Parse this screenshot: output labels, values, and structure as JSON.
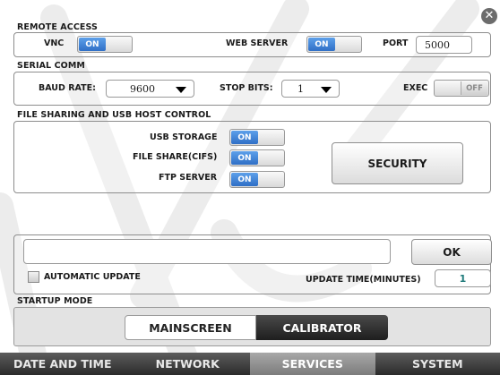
{
  "window": {
    "close_symbol": "✕"
  },
  "remote_access": {
    "title": "REMOTE ACCESS",
    "vnc_label": "VNC",
    "vnc_state": "ON",
    "web_server_label": "WEB SERVER",
    "web_server_state": "ON",
    "port_label": "PORT",
    "port_value": "5000"
  },
  "serial_comm": {
    "title": "SERIAL COMM",
    "baud_rate_label": "BAUD RATE:",
    "baud_rate_value": "9600",
    "stop_bits_label": "STOP BITS:",
    "stop_bits_value": "1",
    "exec_label": "EXEC",
    "exec_state": "OFF"
  },
  "file_sharing": {
    "title": "FILE SHARING AND USB HOST CONTROL",
    "usb_storage_label": "USB STORAGE",
    "usb_storage_state": "ON",
    "file_share_label": "FILE SHARE(CIFS)",
    "file_share_state": "ON",
    "ftp_server_label": "FTP SERVER",
    "ftp_server_state": "ON",
    "security_label": "SECURITY"
  },
  "update": {
    "input_value": "",
    "ok_label": "OK",
    "auto_update_label": "AUTOMATIC UPDATE",
    "update_time_label": "UPDATE TIME(MINUTES)",
    "update_time_value": "1"
  },
  "startup_mode": {
    "title": "STARTUP MODE",
    "options": [
      "MAINSCREEN",
      "CALIBRATOR"
    ],
    "selected": "CALIBRATOR"
  },
  "tabs": [
    "DATE AND TIME",
    "NETWORK",
    "SERVICES",
    "SYSTEM"
  ],
  "active_tab": "SERVICES",
  "colors": {
    "toggle_on": "#3f82d6",
    "tab_bar": "#3a3a3a",
    "active_tab": "#909090"
  }
}
